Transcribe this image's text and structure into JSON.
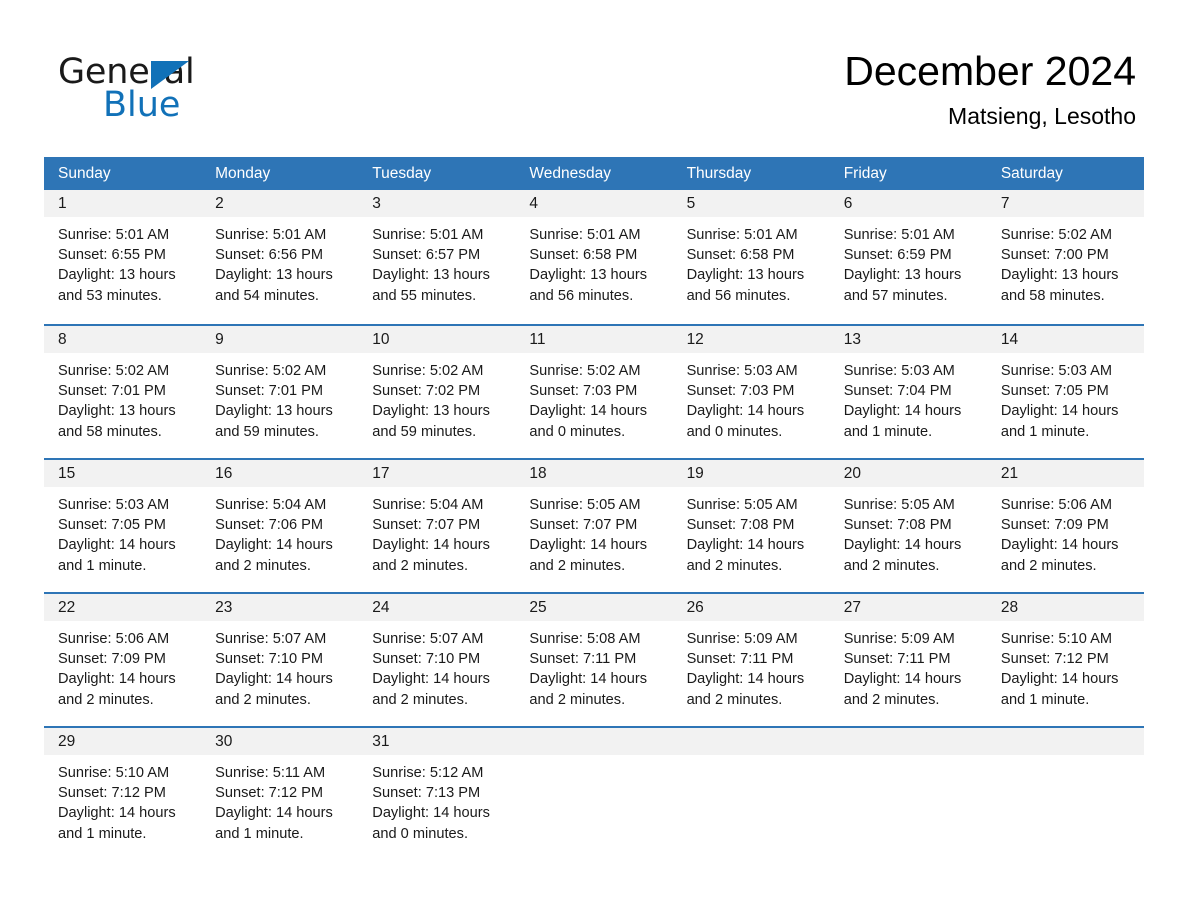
{
  "brand": {
    "name_part1": "General",
    "name_part2": "Blue"
  },
  "header": {
    "title": "December 2024",
    "location": "Matsieng, Lesotho"
  },
  "weekdays": [
    "Sunday",
    "Monday",
    "Tuesday",
    "Wednesday",
    "Thursday",
    "Friday",
    "Saturday"
  ],
  "colors": {
    "header_blue": "#2e75b6",
    "brand_blue": "#1171b8",
    "daynum_band": "#f2f2f2",
    "text": "#1a1a1a"
  },
  "weeks": [
    [
      {
        "day": "1",
        "sunrise": "Sunrise: 5:01 AM",
        "sunset": "Sunset: 6:55 PM",
        "daylight1": "Daylight: 13 hours",
        "daylight2": "and 53 minutes."
      },
      {
        "day": "2",
        "sunrise": "Sunrise: 5:01 AM",
        "sunset": "Sunset: 6:56 PM",
        "daylight1": "Daylight: 13 hours",
        "daylight2": "and 54 minutes."
      },
      {
        "day": "3",
        "sunrise": "Sunrise: 5:01 AM",
        "sunset": "Sunset: 6:57 PM",
        "daylight1": "Daylight: 13 hours",
        "daylight2": "and 55 minutes."
      },
      {
        "day": "4",
        "sunrise": "Sunrise: 5:01 AM",
        "sunset": "Sunset: 6:58 PM",
        "daylight1": "Daylight: 13 hours",
        "daylight2": "and 56 minutes."
      },
      {
        "day": "5",
        "sunrise": "Sunrise: 5:01 AM",
        "sunset": "Sunset: 6:58 PM",
        "daylight1": "Daylight: 13 hours",
        "daylight2": "and 56 minutes."
      },
      {
        "day": "6",
        "sunrise": "Sunrise: 5:01 AM",
        "sunset": "Sunset: 6:59 PM",
        "daylight1": "Daylight: 13 hours",
        "daylight2": "and 57 minutes."
      },
      {
        "day": "7",
        "sunrise": "Sunrise: 5:02 AM",
        "sunset": "Sunset: 7:00 PM",
        "daylight1": "Daylight: 13 hours",
        "daylight2": "and 58 minutes."
      }
    ],
    [
      {
        "day": "8",
        "sunrise": "Sunrise: 5:02 AM",
        "sunset": "Sunset: 7:01 PM",
        "daylight1": "Daylight: 13 hours",
        "daylight2": "and 58 minutes."
      },
      {
        "day": "9",
        "sunrise": "Sunrise: 5:02 AM",
        "sunset": "Sunset: 7:01 PM",
        "daylight1": "Daylight: 13 hours",
        "daylight2": "and 59 minutes."
      },
      {
        "day": "10",
        "sunrise": "Sunrise: 5:02 AM",
        "sunset": "Sunset: 7:02 PM",
        "daylight1": "Daylight: 13 hours",
        "daylight2": "and 59 minutes."
      },
      {
        "day": "11",
        "sunrise": "Sunrise: 5:02 AM",
        "sunset": "Sunset: 7:03 PM",
        "daylight1": "Daylight: 14 hours",
        "daylight2": "and 0 minutes."
      },
      {
        "day": "12",
        "sunrise": "Sunrise: 5:03 AM",
        "sunset": "Sunset: 7:03 PM",
        "daylight1": "Daylight: 14 hours",
        "daylight2": "and 0 minutes."
      },
      {
        "day": "13",
        "sunrise": "Sunrise: 5:03 AM",
        "sunset": "Sunset: 7:04 PM",
        "daylight1": "Daylight: 14 hours",
        "daylight2": "and 1 minute."
      },
      {
        "day": "14",
        "sunrise": "Sunrise: 5:03 AM",
        "sunset": "Sunset: 7:05 PM",
        "daylight1": "Daylight: 14 hours",
        "daylight2": "and 1 minute."
      }
    ],
    [
      {
        "day": "15",
        "sunrise": "Sunrise: 5:03 AM",
        "sunset": "Sunset: 7:05 PM",
        "daylight1": "Daylight: 14 hours",
        "daylight2": "and 1 minute."
      },
      {
        "day": "16",
        "sunrise": "Sunrise: 5:04 AM",
        "sunset": "Sunset: 7:06 PM",
        "daylight1": "Daylight: 14 hours",
        "daylight2": "and 2 minutes."
      },
      {
        "day": "17",
        "sunrise": "Sunrise: 5:04 AM",
        "sunset": "Sunset: 7:07 PM",
        "daylight1": "Daylight: 14 hours",
        "daylight2": "and 2 minutes."
      },
      {
        "day": "18",
        "sunrise": "Sunrise: 5:05 AM",
        "sunset": "Sunset: 7:07 PM",
        "daylight1": "Daylight: 14 hours",
        "daylight2": "and 2 minutes."
      },
      {
        "day": "19",
        "sunrise": "Sunrise: 5:05 AM",
        "sunset": "Sunset: 7:08 PM",
        "daylight1": "Daylight: 14 hours",
        "daylight2": "and 2 minutes."
      },
      {
        "day": "20",
        "sunrise": "Sunrise: 5:05 AM",
        "sunset": "Sunset: 7:08 PM",
        "daylight1": "Daylight: 14 hours",
        "daylight2": "and 2 minutes."
      },
      {
        "day": "21",
        "sunrise": "Sunrise: 5:06 AM",
        "sunset": "Sunset: 7:09 PM",
        "daylight1": "Daylight: 14 hours",
        "daylight2": "and 2 minutes."
      }
    ],
    [
      {
        "day": "22",
        "sunrise": "Sunrise: 5:06 AM",
        "sunset": "Sunset: 7:09 PM",
        "daylight1": "Daylight: 14 hours",
        "daylight2": "and 2 minutes."
      },
      {
        "day": "23",
        "sunrise": "Sunrise: 5:07 AM",
        "sunset": "Sunset: 7:10 PM",
        "daylight1": "Daylight: 14 hours",
        "daylight2": "and 2 minutes."
      },
      {
        "day": "24",
        "sunrise": "Sunrise: 5:07 AM",
        "sunset": "Sunset: 7:10 PM",
        "daylight1": "Daylight: 14 hours",
        "daylight2": "and 2 minutes."
      },
      {
        "day": "25",
        "sunrise": "Sunrise: 5:08 AM",
        "sunset": "Sunset: 7:11 PM",
        "daylight1": "Daylight: 14 hours",
        "daylight2": "and 2 minutes."
      },
      {
        "day": "26",
        "sunrise": "Sunrise: 5:09 AM",
        "sunset": "Sunset: 7:11 PM",
        "daylight1": "Daylight: 14 hours",
        "daylight2": "and 2 minutes."
      },
      {
        "day": "27",
        "sunrise": "Sunrise: 5:09 AM",
        "sunset": "Sunset: 7:11 PM",
        "daylight1": "Daylight: 14 hours",
        "daylight2": "and 2 minutes."
      },
      {
        "day": "28",
        "sunrise": "Sunrise: 5:10 AM",
        "sunset": "Sunset: 7:12 PM",
        "daylight1": "Daylight: 14 hours",
        "daylight2": "and 1 minute."
      }
    ],
    [
      {
        "day": "29",
        "sunrise": "Sunrise: 5:10 AM",
        "sunset": "Sunset: 7:12 PM",
        "daylight1": "Daylight: 14 hours",
        "daylight2": "and 1 minute."
      },
      {
        "day": "30",
        "sunrise": "Sunrise: 5:11 AM",
        "sunset": "Sunset: 7:12 PM",
        "daylight1": "Daylight: 14 hours",
        "daylight2": "and 1 minute."
      },
      {
        "day": "31",
        "sunrise": "Sunrise: 5:12 AM",
        "sunset": "Sunset: 7:13 PM",
        "daylight1": "Daylight: 14 hours",
        "daylight2": "and 0 minutes."
      },
      {
        "day": "",
        "sunrise": "",
        "sunset": "",
        "daylight1": "",
        "daylight2": ""
      },
      {
        "day": "",
        "sunrise": "",
        "sunset": "",
        "daylight1": "",
        "daylight2": ""
      },
      {
        "day": "",
        "sunrise": "",
        "sunset": "",
        "daylight1": "",
        "daylight2": ""
      },
      {
        "day": "",
        "sunrise": "",
        "sunset": "",
        "daylight1": "",
        "daylight2": ""
      }
    ]
  ]
}
